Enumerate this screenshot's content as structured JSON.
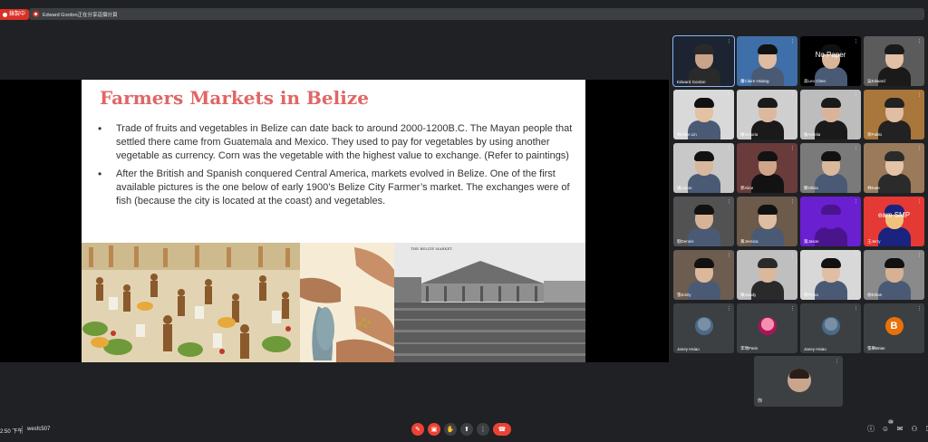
{
  "topbar": {
    "rec_label": "錄製中",
    "title": "Edward Gordon正在分享這個分頁"
  },
  "slide": {
    "title": "Farmers Markets in Belize",
    "bullets": [
      "Trade of fruits and vegetables in Belize can date back to around 2000-1200B.C. The Mayan people that settled there came from Guatemala and Mexico. They used to pay for vegetables by using another vegetable as currency. Corn was the vegetable with the highest value to exchange. (Refer to paintings)",
      "After the British and Spanish conquered Central America, markets evolved in Belize. One of the first available pictures is the one below of early 1900’s Belize City Farmer’s market. The exchanges were of fish (because the city is located at the coast) and vegetables."
    ],
    "photo_caption": "THE BELIZE MARKET."
  },
  "participants": [
    {
      "name": "Edward Gordon",
      "type": "video",
      "colors": [
        "#1b2430",
        "#c9a38a",
        "#2a2a2a"
      ]
    },
    {
      "name": "蕭Claire Hsiang",
      "type": "video",
      "colors": [
        "#3f6fa8",
        "#e0bba0",
        "#111111"
      ]
    },
    {
      "name": "高Leo Chen",
      "type": "video",
      "overlay": "No Paper",
      "colors": [
        "#000000",
        "#d9b59a",
        "#111111"
      ]
    },
    {
      "name": "吳Edward",
      "type": "video",
      "colors": [
        "#5b5b5b",
        "#e2c0a5",
        "#1a1a1a"
      ]
    },
    {
      "name": "林Allen Lin",
      "type": "video",
      "colors": [
        "#d9d9d9",
        "#e3c1a2",
        "#111111"
      ]
    },
    {
      "name": "陳Victoria",
      "type": "video",
      "colors": [
        "#cfcfcf",
        "#dcb99e",
        "#1a1a1a"
      ]
    },
    {
      "name": "詹Amelia",
      "type": "video",
      "colors": [
        "#bdbdbd",
        "#d9b49a",
        "#1a1a1a"
      ]
    },
    {
      "name": "梁Pablo",
      "type": "video",
      "colors": [
        "#a9763c",
        "#e0bda3",
        "#222222"
      ]
    },
    {
      "name": "楊Aaron",
      "type": "video",
      "colors": [
        "#c8c8c8",
        "#d8b79c",
        "#111111"
      ]
    },
    {
      "name": "郭Alice",
      "type": "video",
      "colors": [
        "#6a3b3b",
        "#cfa58a",
        "#121212"
      ]
    },
    {
      "name": "鄭Olivia",
      "type": "video",
      "colors": [
        "#7a7a7a",
        "#d9b89c",
        "#111111"
      ]
    },
    {
      "name": "林Kate",
      "type": "video",
      "colors": [
        "#9a7a5a",
        "#e4c3a6",
        "#2b2b2b"
      ]
    },
    {
      "name": "劉Dennis",
      "type": "video",
      "colors": [
        "#525252",
        "#d6b396",
        "#111111"
      ]
    },
    {
      "name": "黃Jessica",
      "type": "video",
      "colors": [
        "#6c5a4a",
        "#dfbda2",
        "#111111"
      ]
    },
    {
      "name": "葉Jason",
      "type": "video",
      "colors": [
        "#6a1fd1",
        "#6a1fd1",
        "#4a148c"
      ]
    },
    {
      "name": "王Jerry",
      "type": "video",
      "overlay": "eam SMP",
      "colors": [
        "#e53935",
        "#f1c27d",
        "#1a237e"
      ]
    },
    {
      "name": "張Emily",
      "type": "video",
      "colors": [
        "#6d5d50",
        "#dcb89a",
        "#111111"
      ]
    },
    {
      "name": "陳Sandy",
      "type": "video",
      "colors": [
        "#bfbfbf",
        "#d9b89c",
        "#2a2a2a"
      ]
    },
    {
      "name": "蔡Fiona",
      "type": "video",
      "colors": [
        "#d8d8d8",
        "#e0bea3",
        "#111111"
      ]
    },
    {
      "name": "徐Ethan",
      "type": "video",
      "colors": [
        "#8a8a8a",
        "#d6b194",
        "#111111"
      ]
    },
    {
      "name": "Janey Hsiao",
      "type": "avatar",
      "colors": [
        "#3c4043",
        "#7a8fa6",
        "#4a6a8a"
      ]
    },
    {
      "name": "李瑀Paris",
      "type": "avatar",
      "colors": [
        "#3c4043",
        "#f48fb1",
        "#ad1457"
      ]
    },
    {
      "name": "Janey Hsiao",
      "type": "avatar",
      "colors": [
        "#3c4043",
        "#7a8fa6",
        "#4a6a8a"
      ]
    },
    {
      "name": "張樂Brian",
      "type": "letter",
      "letter": "B",
      "colors": [
        "#3c4043",
        "#e8710a",
        "#e8710a"
      ]
    }
  ],
  "self_view": {
    "name": "你"
  },
  "bottombar": {
    "time": "2:50 下午",
    "meeting_code": "wesfc507",
    "participant_count": "25"
  }
}
